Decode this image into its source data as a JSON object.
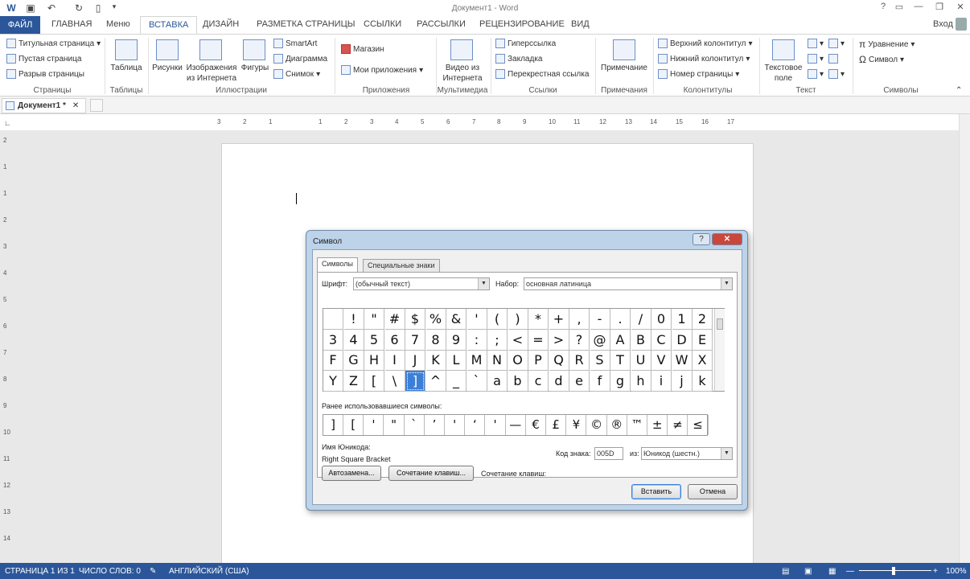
{
  "window": {
    "title": "Документ1 - Word",
    "help": "?",
    "min": "—",
    "max": "❐",
    "close": "✕",
    "signin": "Вход"
  },
  "ribbon_tabs": [
    "ФАЙЛ",
    "ГЛАВНАЯ",
    "Меню",
    "ВСТАВКА",
    "ДИЗАЙН",
    "РАЗМЕТКА СТРАНИЦЫ",
    "ССЫЛКИ",
    "РАССЫЛКИ",
    "РЕЦЕНЗИРОВАНИЕ",
    "ВИД"
  ],
  "ribbon": {
    "pages": {
      "cover": "Титульная страница",
      "blank": "Пустая страница",
      "break": "Разрыв страницы",
      "label": "Страницы"
    },
    "tables": {
      "table": "Таблица",
      "label": "Таблицы"
    },
    "illustrations": {
      "pictures": "Рисунки",
      "online1": "Изображения",
      "online2": "из Интернета",
      "shapes": "Фигуры",
      "smartart": "SmartArt",
      "chart": "Диаграмма",
      "screenshot": "Снимок",
      "label": "Иллюстрации"
    },
    "apps": {
      "store": "Магазин",
      "myapps": "Мои приложения",
      "label": "Приложения"
    },
    "media": {
      "video1": "Видео из",
      "video2": "Интернета",
      "label": "Мультимедиа"
    },
    "links": {
      "hyperlink": "Гиперссылка",
      "bookmark": "Закладка",
      "crossref": "Перекрестная ссылка",
      "label": "Ссылки"
    },
    "comments": {
      "comment": "Примечание",
      "label": "Примечания"
    },
    "headerfooter": {
      "header": "Верхний колонтитул",
      "footer": "Нижний колонтитул",
      "pagenum": "Номер страницы",
      "label": "Колонтитулы"
    },
    "text": {
      "textbox1": "Текстовое",
      "textbox2": "поле",
      "label": "Текст"
    },
    "symbols": {
      "equation": "Уравнение",
      "symbol": "Символ",
      "label": "Символы"
    }
  },
  "doc_tab": "Документ1 *",
  "hruler_labels": [
    "3",
    "2",
    "1",
    "1",
    "2",
    "3",
    "4",
    "5",
    "6",
    "7",
    "8",
    "9",
    "10",
    "11",
    "12",
    "13",
    "14",
    "15",
    "16",
    "17"
  ],
  "vruler_labels": [
    "2",
    "1",
    "1",
    "2",
    "3",
    "4",
    "5",
    "6",
    "7",
    "8",
    "9",
    "10",
    "11",
    "12",
    "13",
    "14"
  ],
  "dialog": {
    "title": "Символ",
    "tabs": [
      "Символы",
      "Специальные знаки"
    ],
    "font_label": "Шрифт:",
    "font_value": "(обычный текст)",
    "subset_label": "Набор:",
    "subset_value": "основная латиница",
    "grid": [
      [
        " ",
        "!",
        "\"",
        "#",
        "$",
        "%",
        "&",
        "'",
        "(",
        ")",
        "*",
        "+",
        ",",
        "-",
        ".",
        "/",
        "0",
        "1",
        "2"
      ],
      [
        "3",
        "4",
        "5",
        "6",
        "7",
        "8",
        "9",
        ":",
        ";",
        "<",
        "=",
        ">",
        "?",
        "@",
        "A",
        "B",
        "C",
        "D",
        "E"
      ],
      [
        "F",
        "G",
        "H",
        "I",
        "J",
        "K",
        "L",
        "M",
        "N",
        "O",
        "P",
        "Q",
        "R",
        "S",
        "T",
        "U",
        "V",
        "W",
        "X"
      ],
      [
        "Y",
        "Z",
        "[",
        "\\",
        "]",
        "^",
        "_",
        "`",
        "a",
        "b",
        "c",
        "d",
        "e",
        "f",
        "g",
        "h",
        "i",
        "j",
        "k"
      ]
    ],
    "selected_row": 3,
    "selected_col": 4,
    "recent_label": "Ранее использовавшиеся символы:",
    "recent": [
      "]",
      "[",
      "'",
      "\"",
      "`",
      "’",
      "'",
      "‘",
      "'",
      "—",
      "€",
      "£",
      "¥",
      "©",
      "®",
      "™",
      "±",
      "≠",
      "≤"
    ],
    "unicode_name_label": "Имя Юникода:",
    "unicode_name": "Right Square Bracket",
    "code_label": "Код знака:",
    "code_value": "005D",
    "from_label": "из:",
    "from_value": "Юникод (шестн.)",
    "autocorrect": "Автозамена...",
    "shortcut_btn": "Сочетание клавиш...",
    "shortcut_label": "Сочетание клавиш:",
    "insert": "Вставить",
    "cancel": "Отмена"
  },
  "status": {
    "page": "СТРАНИЦА 1 ИЗ 1",
    "words": "ЧИСЛО СЛОВ: 0",
    "lang": "АНГЛИЙСКИЙ (США)",
    "zoom": "100%"
  }
}
